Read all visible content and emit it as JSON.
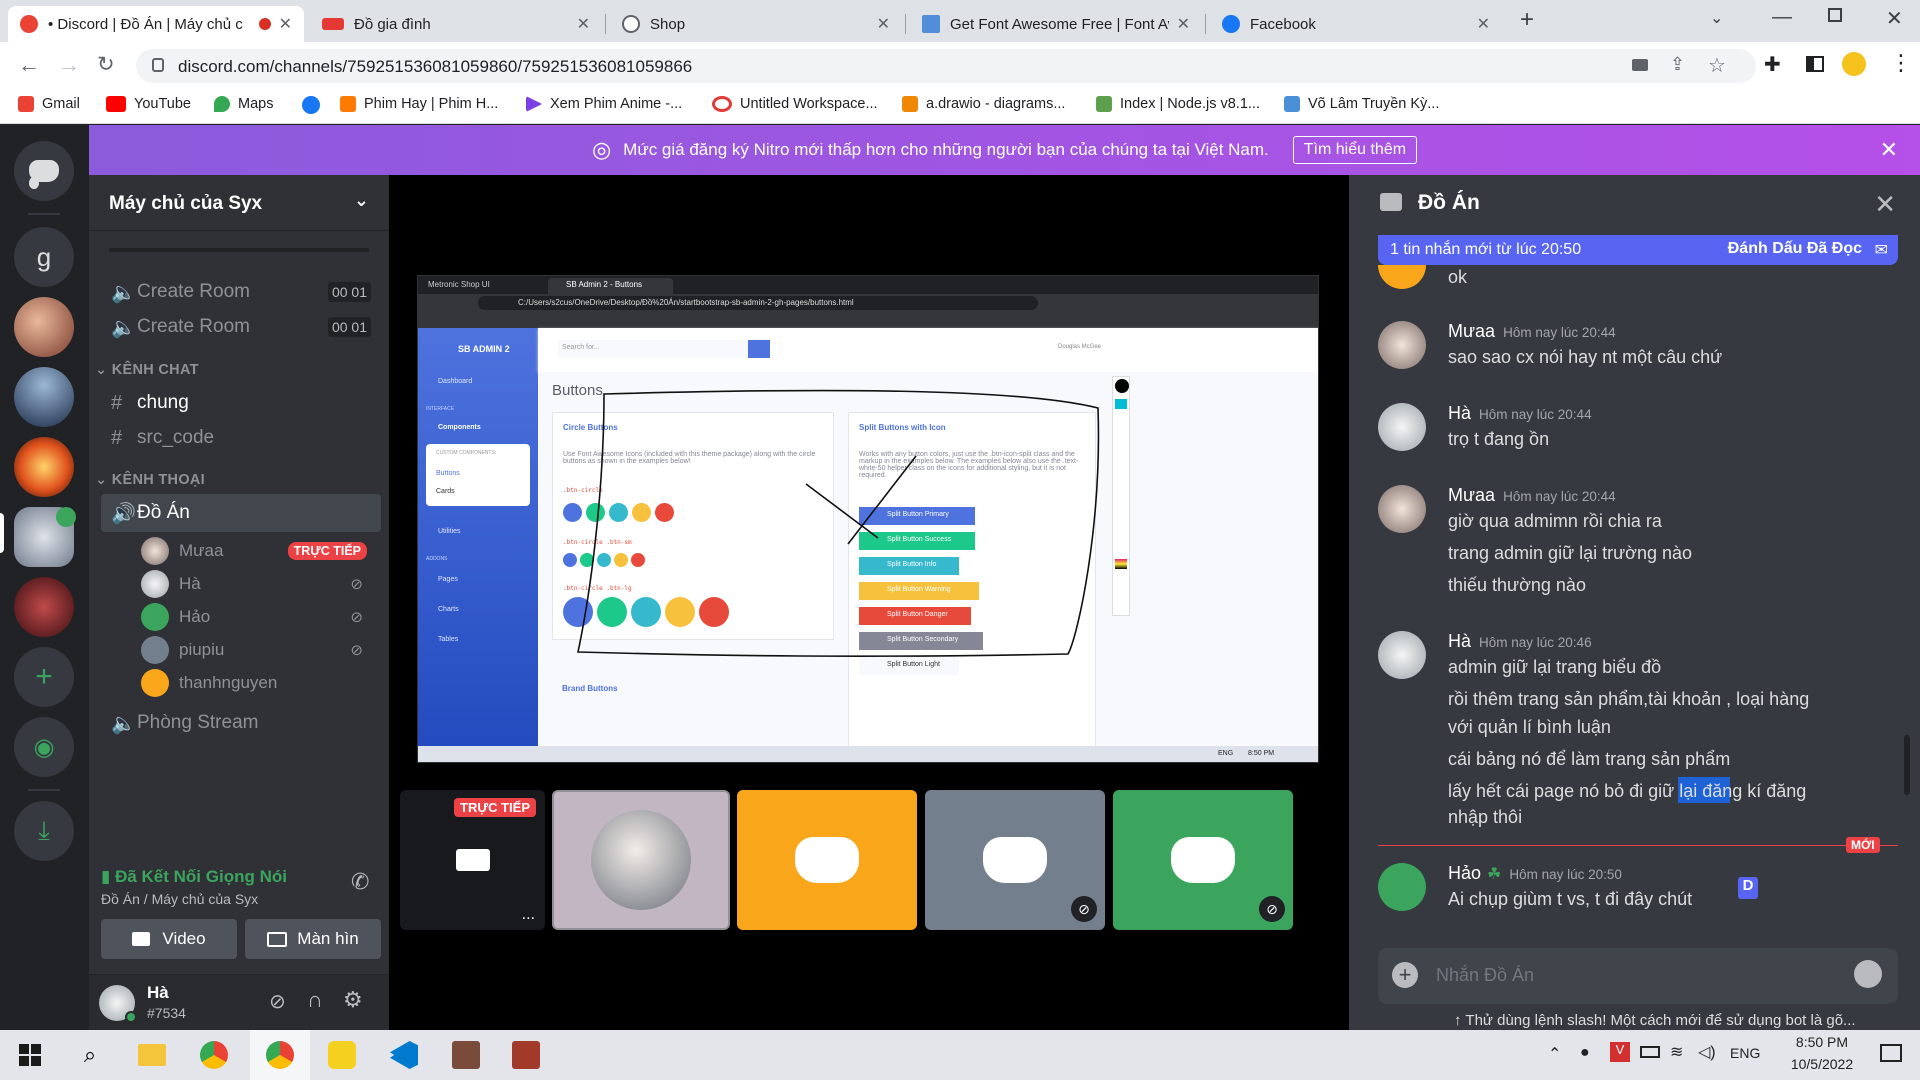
{
  "browser": {
    "tabs": [
      {
        "title": "• Discord | Đồ Án | Máy chủ c",
        "active": true
      },
      {
        "title": "Đồ gia đình",
        "active": false
      },
      {
        "title": "Shop",
        "active": false
      },
      {
        "title": "Get Font Awesome Free | Font Av",
        "active": false
      },
      {
        "title": "Facebook",
        "active": false
      }
    ],
    "url": "discord.com/channels/759251536081059860/759251536081059866",
    "bookmarks": [
      "Gmail",
      "YouTube",
      "Maps",
      "Phim Hay | Phim H...",
      "Xem Phim Anime -...",
      "Untitled Workspace...",
      "a.drawio - diagrams...",
      "Index | Node.js v8.1...",
      "Võ Lâm Truyền Kỳ..."
    ]
  },
  "nitro_banner": {
    "text": "Mức giá đăng ký Nitro mới thấp hơn cho những người bạn của chúng ta tại Việt Nam.",
    "button": "Tìm hiểu thêm"
  },
  "guild_letter": "g",
  "server": {
    "name": "Máy chủ của Syx",
    "rooms": [
      {
        "name": "Create Room",
        "count_a": "00",
        "count_b": "01"
      },
      {
        "name": "Create Room",
        "count_a": "00",
        "count_b": "01"
      }
    ],
    "cat_chat": "KÊNH CHAT",
    "text_channels": [
      "chung",
      "src_code"
    ],
    "cat_voice": "KÊNH THOẠI",
    "voice_channel": "Đồ Án",
    "voice_users": [
      {
        "name": "Mưaa",
        "badge": "TRỰC TIẾP"
      },
      {
        "name": "Hà"
      },
      {
        "name": "Hảo"
      },
      {
        "name": "piupiu"
      },
      {
        "name": "thanhnguyen"
      }
    ],
    "stream_channel": "Phòng Stream"
  },
  "voice_status": {
    "title": "Đã Kết Nối Giọng Nói",
    "subtitle": "Đồ Án / Máy chủ của Syx",
    "video_btn": "Video",
    "screen_btn": "Màn hìn"
  },
  "user": {
    "name": "Hà",
    "tag": "#7534"
  },
  "stage": {
    "live_badge": "TRỰC TIẾP",
    "more": "..."
  },
  "inner_screenshot": {
    "tabs": [
      "Metronic Shop UI",
      "SB Admin 2 - Buttons"
    ],
    "path": "C:/Users/s2cus/OneDrive/Desktop/Đồ%20Án/startbootstrap-sb-admin-2-gh-pages/buttons.html",
    "brand": "SB ADMIN 2",
    "search_placeholder": "Search for...",
    "user_name": "Douglas McGee",
    "nav": [
      "Dashboard",
      "INTERFACE",
      "Components",
      "CUSTOM COMPONENTS:",
      "Buttons",
      "Cards",
      "Utilities",
      "ADDONS",
      "Pages",
      "Charts",
      "Tables"
    ],
    "page_title": "Buttons",
    "card1_title": "Circle Buttons",
    "card1_text": "Use Font Awesome Icons (included with this theme package) along with the circle buttons as shown in the examples below!",
    "code1": ".btn-circle",
    "code2": ".btn-circle .btn-sm",
    "code3": ".btn-circle .btn-lg",
    "card2_title": "Split Buttons with Icon",
    "card2_text": "Works with any button colors, just use the .btn-icon-split class and the markup in the examples below. The examples below also use the .text-white-50 helper class on the icons for additional styling, but it is not required.",
    "split_buttons": [
      "Split Button Primary",
      "Split Button Success",
      "Split Button Info",
      "Split Button Warning",
      "Split Button Danger",
      "Split Button Secondary",
      "Split Button Light"
    ],
    "brand_buttons": "Brand Buttons",
    "taskbar_lang": "ENG",
    "taskbar_time": "8:50 PM"
  },
  "chat": {
    "channel": "Đồ Án",
    "new_bar": "1 tin nhắn mới từ lúc 20:50",
    "mark_read": "Đánh Dấu Đã Đọc",
    "first_line": "ok",
    "messages": [
      {
        "author": "Mưaa",
        "time": "Hôm nay lúc 20:44",
        "lines": [
          "sao sao cx nói hay nt một câu chứ"
        ]
      },
      {
        "author": "Hà",
        "time": "Hôm nay lúc 20:44",
        "lines": [
          "trọ t đang ồn"
        ]
      },
      {
        "author": "Mưaa",
        "time": "Hôm nay lúc 20:44",
        "lines": [
          "giờ qua admimn rồi chia ra",
          "trang admin giữ lại trường nào",
          "thiếu thường nào"
        ]
      },
      {
        "author": "Hà",
        "time": "Hôm nay lúc 20:46",
        "lines": [
          "admin giữ lại trang biểu đồ",
          "rồi thêm trang sản phẩm,tài khoản , loại hàng",
          "với quản lí bình luận",
          "cái bảng nó để làm trang sản phẩm",
          "lấy hết cái page nó bỏ đi giữ lại đăng kí đăng",
          "nhập thôi"
        ]
      },
      {
        "author": "Hảo",
        "time": "Hôm nay lúc 20:50",
        "lines": [
          "Ai chụp giùm t vs, t đi đây chút"
        ]
      }
    ],
    "new_label": "MỚI",
    "input_placeholder": "Nhắn Đồ Án",
    "tip": "Thử dùng lệnh slash! Một cách mới để sử dụng bot là gõ..."
  },
  "taskbar": {
    "lang": "ENG",
    "time": "8:50 PM",
    "date": "10/5/2022"
  },
  "colors": {
    "blurple": "#5865f2",
    "red": "#ed4245",
    "green": "#3ba55d",
    "orange": "#faa61a",
    "gray": "#747f8d"
  }
}
